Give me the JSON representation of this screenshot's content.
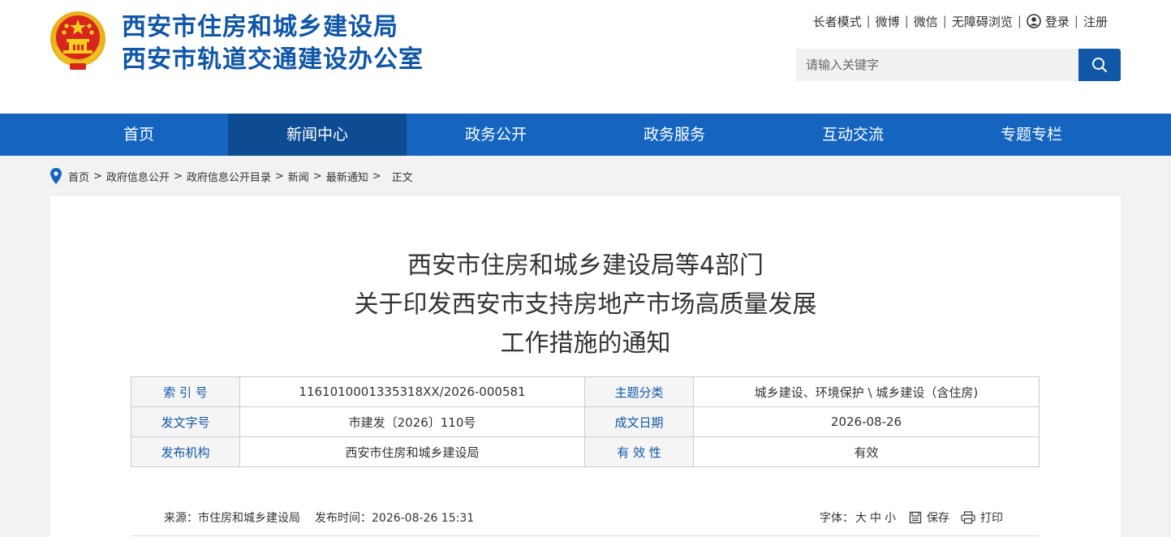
{
  "header": {
    "site_name_line1": "西安市住房和城乡建设局",
    "site_name_line2": "西安市轨道交通建设办公室",
    "top_links": {
      "elder_mode": "长者模式",
      "weibo": "微博",
      "wechat": "微信",
      "accessible": "无障碍浏览",
      "login": "登录",
      "register": "注册",
      "separator": "|"
    },
    "search": {
      "placeholder": "请输入关键字"
    }
  },
  "nav": {
    "items": [
      {
        "label": "首页"
      },
      {
        "label": "新闻中心"
      },
      {
        "label": "政务公开"
      },
      {
        "label": "政务服务"
      },
      {
        "label": "互动交流"
      },
      {
        "label": "专题专栏"
      }
    ],
    "active_index": 1
  },
  "breadcrumb": {
    "items": [
      "首页",
      "政府信息公开",
      "政府信息公开目录",
      "新闻",
      "最新通知"
    ],
    "separator": ">",
    "current": "正文"
  },
  "article": {
    "title_lines": [
      "西安市住房和城乡建设局等4部门",
      "关于印发西安市支持房地产市场高质量发展",
      "工作措施的通知"
    ],
    "meta": {
      "index_label": "索 引 号",
      "index_value": "1161010001335318XX/2026-000581",
      "topic_label": "主题分类",
      "topic_value": "城乡建设、环境保护 \\ 城乡建设（含住房)",
      "doc_no_label": "发文字号",
      "doc_no_value": "市建发〔2026〕110号",
      "date_label": "成文日期",
      "date_value": "2026-08-26",
      "issuer_label": "发布机构",
      "issuer_value": "西安市住房和城乡建设局",
      "validity_label": "有 效 性",
      "validity_value": "有效"
    },
    "source": {
      "source_label": "来源：",
      "source_value": "市住房和城乡建设局",
      "time_label": "发布时间：",
      "time_value": "2026-08-26 15:31"
    },
    "tools": {
      "font_label": "字体：",
      "large": "大",
      "medium": "中",
      "small": "小",
      "save": "保存",
      "print": "打印"
    }
  },
  "colors": {
    "brand_blue": "#1057a8",
    "nav_blue": "#1565c0",
    "nav_active": "#0d4b92",
    "emblem_red": "#d7261e",
    "emblem_gold": "#f5c518"
  }
}
